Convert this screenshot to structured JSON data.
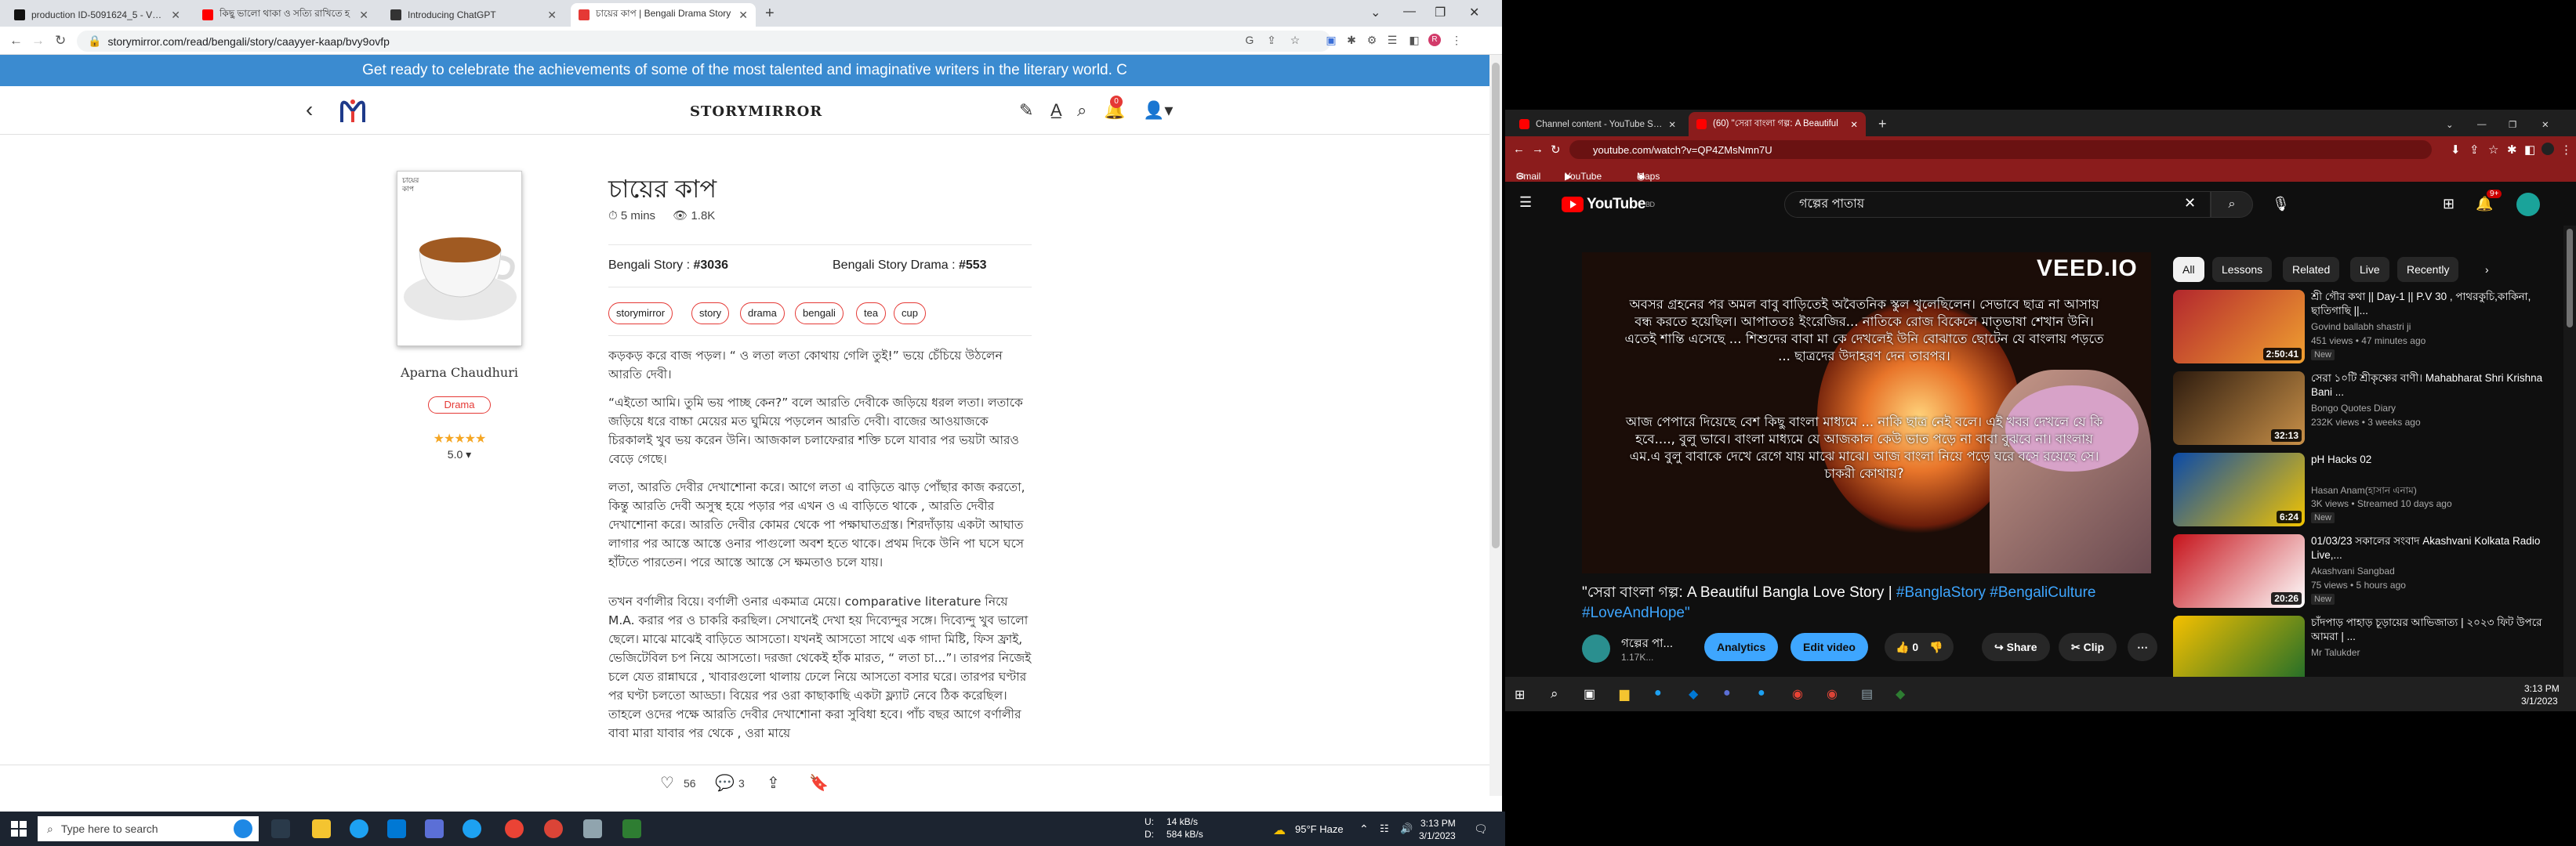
{
  "left_browser": {
    "tabs": [
      {
        "label": "production ID-5091624_5 - VEED",
        "fav_color": "#111111"
      },
      {
        "label": "কিছু ভালো থাকা ও সত্যি রাখিতে হ",
        "fav_color": "#ff0000"
      },
      {
        "label": "Introducing ChatGPT",
        "fav_color": "#333333"
      },
      {
        "label": "চায়ের কাপ | Bengali Drama Story",
        "fav_color": "#e53935"
      }
    ],
    "url": "storymirror.com/read/bengali/story/caayyer-kaap/bvy9ovfp",
    "banner": "Get ready to celebrate the achievements of some of the most talented and imaginative writers in the literary world. C",
    "brand": "STORYMIRROR",
    "notif_count": "0",
    "book": {
      "cover_text": "চায়ের কাপ",
      "author": "Aparna Chaudhuri",
      "genre": "Drama",
      "rating": "5.0",
      "stars": "★★★★★"
    },
    "story": {
      "title": "চায়ের কাপ",
      "read_time": "5 mins",
      "views": "1.8K",
      "cat1_label": "Bengali Story : ",
      "cat1_rank": "#3036",
      "cat2_label": "Bengali Story Drama : ",
      "cat2_rank": "#553",
      "tags": [
        "storymirror",
        "story",
        "drama",
        "bengali",
        "tea",
        "cup"
      ],
      "paragraphs": [
        "কড়কড় করে বাজ পড়ল। “ ও লতা লতা কোথায় গেলি তুই!” ভয়ে চেঁচিয়ে উঠলেন আরতি দেবী।",
        "“এইতো আমি। তুমি ভয় পাচ্ছ কেন?” বলে আরতি দেবীকে জড়িয়ে ধরল লতা। লতাকে জড়িয়ে ধরে বাচ্চা মেয়ের মত ঘুমিয়ে পড়লেন আরতি দেবী। বাজের আওয়াজকে চিরকালই খুব ভয় করেন উনি। আজকাল চলাফেরার শক্তি চলে যাবার পর ভয়টা আরও বেড়ে গেছে।",
        "লতা, আরতি দেবীর দেখাশোনা করে। আগে লতা এ বাড়িতে ঝাড় পোঁছার কাজ করতো, কিন্তু আরতি দেবী অসুস্থ হয়ে পড়ার পর এখন ও এ বাড়িতে থাকে , আরতি দেবীর দেখাশোনা করে। আরতি দেবীর কোমর থেকে পা পক্ষাঘাতগ্রস্ত। শিরদাঁড়ায় একটা আঘাত লাগার পর আস্তে আস্তে ওনার পাগুলো অবশ হতে থাকে। প্রথম দিকে উনি পা ঘসে ঘসে হাঁটতে পারতেন। পরে আস্তে আস্তে সে ক্ষমতাও চলে যায়।",
        "তখন বর্ণালীর বিয়ে। বর্ণালী ওনার একমাত্র মেয়ে। comparative literature নিয়ে M.A. করার পর ও চাকরি করছিল। সেখানেই দেখা হয় দিব্যেন্দুর সঙ্গে। দিব্যেন্দু খুব ভালো ছেলে। মাঝে মাঝেই বাড়িতে আসতো। যখনই আসতো সাথে এক গাদা মিষ্টি, ফিস ফ্রাই, ভেজিটেবিল চপ নিয়ে আসতো। দরজা থেকেই হাঁক মারত, “ লতা চা...”। তারপর নিজেই চলে যেত রান্নাঘরে , খাবারগুলো থালায় ঢেলে নিয়ে আসতো বসার ঘরে। তারপর ঘণ্টার পর ঘণ্টা চলতো আড্ডা। বিয়ের পর ওরা কাছাকাছি একটা ফ্ল্যাট নেবে ঠিক করেছিল। তাহলে ওদের পক্ষে আরতি দেবীর দেখাশোনা করা সুবিধা হবে। পাঁচ বছর আগে বর্ণালীর বাবা মারা যাবার পর থেকে , ওরা মায়ে"
      ],
      "likes": "56",
      "comments": "3"
    },
    "taskbar": {
      "search_placeholder": "Type here to search",
      "net_up": "U:",
      "net_up_val": "14 kB/s",
      "net_down": "D:",
      "net_down_val": "584 kB/s",
      "weather": "95°F  Haze",
      "time": "3:13 PM",
      "date": "3/1/2023"
    }
  },
  "right_browser": {
    "tabs": [
      {
        "label": "Channel content - YouTube Stud"
      },
      {
        "label": "(60) \"সেরা বাংলা গল্প: A Beautiful"
      }
    ],
    "url": "youtube.com/watch?v=QP4ZMsNmn7U",
    "bookmarks": [
      "Gmail",
      "YouTube",
      "Maps"
    ],
    "yt": {
      "logo": "YouTube",
      "country": "BD",
      "search_value": "গল্পের পাতায়",
      "notif_count": "9+",
      "player_brand": "VEED.IO",
      "caption1": "অবসর গ্রহনের পর অমল বাবু বাড়িতেই অবৈতনিক স্কুল খুলেছিলেন। সেভাবে ছাত্র না আসায় বন্ধ করতে হয়েছিল। আপাততঃ ইংরেজির... নাতিকে রোজ বিকেলে মাতৃভাষা শেখান উনি। এতেই শান্তি এসেছে ... শিশুদের বাবা মা কে দেখলেই উনি বোঝাতে ছোটেন যে বাংলায় পড়তে ... ছাত্রদের উদাহরণ দেন তারপর।",
      "caption2": "আজ পেপারে দিয়েছে বেশ কিছু বাংলা মাধ্যমে ... নাকি ছাত্র নেই বলে। এই খবর দেখলে যে কি হবে...., বুলু ভাবে। বাংলা মাধ্যমে যে আজকাল কেউ ভাত পড়ে না বাবা বুঝবে না। বাংলায় এম.এ বুলু বাবাকে দেখে রেগে যায় মাঝে মাঝে। আজ বাংলা নিয়ে পড়ে ঘরে বসে রয়েছে সে। চাকরী কোথায়?",
      "title_pre": "\"সেরা বাংলা গল্প: A Beautiful Bangla Love Story | ",
      "title_tags": "#BanglaStory #BengaliCulture #LoveAndHope\"",
      "channel": "গল্পের পা...",
      "subs": "1.17K...",
      "analytics": "Analytics",
      "edit": "Edit video",
      "likes": "0",
      "share": "Share",
      "clip": "Clip",
      "chips": [
        "All",
        "Lessons",
        "Related",
        "Live",
        "Recently"
      ],
      "recs": [
        {
          "title": "শ্রী গৌর কথা || Day-1 || P.V 30 , পাথরকুচি,কাকিনা, ছাতিগাছি ||...",
          "channel": "Govind ballabh shastri ji",
          "meta": "451 views • 47 minutes ago",
          "badge": "New",
          "dur": "2:50:41",
          "c1": "#b3272d",
          "c2": "#f0a030"
        },
        {
          "title": "সেরা ১০টি শ্রীকৃষ্ণের বাণী। Mahabharat Shri Krishna Bani ...",
          "channel": "Bongo Quotes Diary",
          "meta": "232K views • 3 weeks ago",
          "badge": "",
          "dur": "32:13",
          "c1": "#2d1b0e",
          "c2": "#c89048"
        },
        {
          "title": "pH Hacks 02",
          "channel": "Hasan Anam(হাসান এনাম)",
          "meta": "3K views • Streamed 10 days ago",
          "badge": "New",
          "dur": "6:24",
          "c1": "#0a4aa8",
          "c2": "#f2c400"
        },
        {
          "title": "01/03/23 সকালের সংবাদ Akashvani Kolkata Radio Live,...",
          "channel": "Akashvani Sangbad",
          "meta": "75 views • 5 hours ago",
          "badge": "New",
          "dur": "20:26",
          "c1": "#c6131b",
          "c2": "#ffffff"
        },
        {
          "title": "চাঁদপাড় পাহাড় চূড়ায়ের আভিজাত্য | ২০২৩ ফিট উপরে আমরা | ...",
          "channel": "Mr Talukder",
          "meta": "",
          "badge": "",
          "dur": "",
          "c1": "#f5c000",
          "c2": "#1a6b2a"
        }
      ]
    },
    "taskbar": {
      "time": "3:13 PM",
      "date": "3/1/2023"
    }
  }
}
